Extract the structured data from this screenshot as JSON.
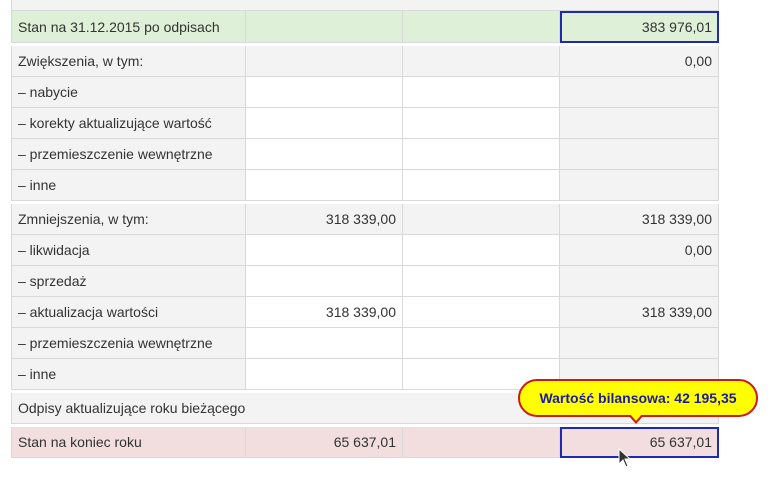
{
  "rows": [
    {
      "label": "Stan na 31.12.2015 po odpisach",
      "c1": "",
      "c2": "",
      "c3": "383 976,01"
    },
    {
      "label": "Zwiększenia, w tym:",
      "c1": "",
      "c2": "",
      "c3": "0,00"
    },
    {
      "label": "– nabycie",
      "c1": "",
      "c2": "",
      "c3": ""
    },
    {
      "label": "– korekty aktualizujące wartość",
      "c1": "",
      "c2": "",
      "c3": ""
    },
    {
      "label": "– przemieszczenie wewnętrzne",
      "c1": "",
      "c2": "",
      "c3": ""
    },
    {
      "label": "– inne",
      "c1": "",
      "c2": "",
      "c3": ""
    },
    {
      "label": "Zmniejszenia, w tym:",
      "c1": "318 339,00",
      "c2": "",
      "c3": "318 339,00"
    },
    {
      "label": "– likwidacja",
      "c1": "",
      "c2": "",
      "c3": "0,00"
    },
    {
      "label": "– sprzedaż",
      "c1": "",
      "c2": "",
      "c3": ""
    },
    {
      "label": "– aktualizacja wartości",
      "c1": "318 339,00",
      "c2": "",
      "c3": "318 339,00"
    },
    {
      "label": "– przemieszczenia wewnętrzne",
      "c1": "",
      "c2": "",
      "c3": ""
    },
    {
      "label": "– inne",
      "c1": "",
      "c2": "",
      "c3": ""
    },
    {
      "label": "Odpisy aktualizujące roku bieżącego"
    },
    {
      "label": "Stan na koniec roku",
      "c1": "65 637,01",
      "c2": "",
      "c3": "65 637,01"
    }
  ],
  "tooltip": {
    "text": "Wartość bilansowa: 42 195,35"
  }
}
